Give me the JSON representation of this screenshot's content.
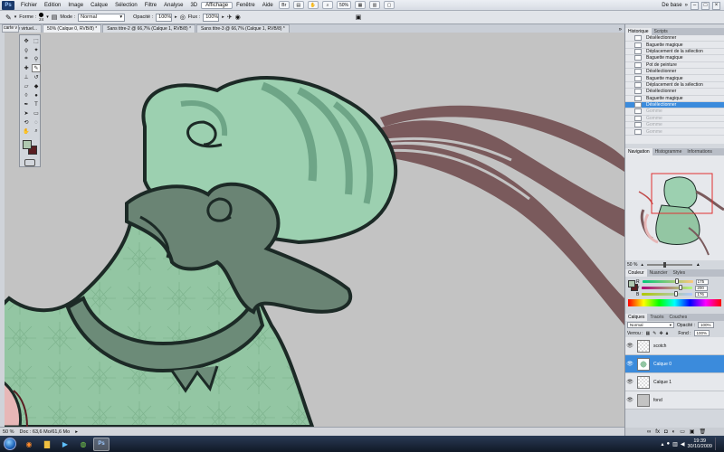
{
  "menubar": {
    "logo": "Ps",
    "items": [
      "Fichier",
      "Edition",
      "Image",
      "Calque",
      "Sélection",
      "Filtre",
      "Analyse",
      "3D",
      "Affichage",
      "Fenêtre",
      "Aide"
    ],
    "zoom": "50%",
    "workspace": "De base"
  },
  "options": {
    "forme_label": "Forme :",
    "brush_size": "24",
    "mode_label": "Mode :",
    "mode_value": "Normal",
    "opacite_label": "Opacité :",
    "opacite_value": "100%",
    "flux_label": "Flux :",
    "flux_value": "100%"
  },
  "tabs": [
    "carte virtuel...",
    "50% (Calque 0, RVB/8) *",
    "Sans titre-2 @ 66,7% (Calque 1, RVB/8) *",
    "Sans titre-3 @ 66,7% (Calque 1, RVB/8) *"
  ],
  "status": {
    "zoom": "50 %",
    "doc": "Doc : 63,6 Mo/61,6 Mo"
  },
  "panels": {
    "history_tabs": [
      "Historique",
      "Scripts"
    ],
    "history": [
      {
        "label": "Désélectionner",
        "state": "normal"
      },
      {
        "label": "Baguette magique",
        "state": "normal"
      },
      {
        "label": "Déplacement de la sélection",
        "state": "normal"
      },
      {
        "label": "Baguette magique",
        "state": "normal"
      },
      {
        "label": "Pot de peinture",
        "state": "normal"
      },
      {
        "label": "Désélectionner",
        "state": "normal"
      },
      {
        "label": "Baguette magique",
        "state": "normal"
      },
      {
        "label": "Déplacement de la sélection",
        "state": "normal"
      },
      {
        "label": "Désélectionner",
        "state": "normal"
      },
      {
        "label": "Baguette magique",
        "state": "normal"
      },
      {
        "label": "Désélectionner",
        "state": "selected"
      },
      {
        "label": "Gomme",
        "state": "undone"
      },
      {
        "label": "Gomme",
        "state": "undone"
      },
      {
        "label": "Gomme",
        "state": "undone"
      },
      {
        "label": "Gomme",
        "state": "undone"
      }
    ],
    "nav_tabs": [
      "Navigation",
      "Histogramme",
      "Informations"
    ],
    "nav_zoom": "50 %",
    "color_tabs": [
      "Couleur",
      "Nuancier",
      "Styles"
    ],
    "colors": [
      {
        "ch": "R",
        "value": "175",
        "pos": 0.69,
        "grad": "linear-gradient(90deg,#00c878,#ffc878)"
      },
      {
        "ch": "V",
        "value": "200",
        "pos": 0.78,
        "grad": "linear-gradient(90deg,#af0078,#afff78)"
      },
      {
        "ch": "B",
        "value": "176",
        "pos": 0.69,
        "grad": "linear-gradient(90deg,#afc800,#afc8ff)"
      }
    ],
    "layers_tabs": [
      "Calques",
      "Tracés",
      "Couches"
    ],
    "layers_mode": "Normal",
    "layers_opacity_label": "Opacité :",
    "layers_opacity": "100%",
    "verrou_label": "Verrou :",
    "fond_label": "Fond :",
    "fond_value": "100%",
    "layers": [
      {
        "name": "scotch",
        "selected": false
      },
      {
        "name": "Calque 0",
        "selected": true
      },
      {
        "name": "Calque 1",
        "selected": false
      },
      {
        "name": "fond",
        "selected": false
      }
    ]
  },
  "taskbar": {
    "time": "19:39",
    "date": "30/10/2009"
  },
  "palette": {
    "foreground": "#afc8b0",
    "background": "#5a1e22",
    "selection": "#3b8bdc",
    "skin": "#93c6a3",
    "outline": "#1c2a26"
  }
}
